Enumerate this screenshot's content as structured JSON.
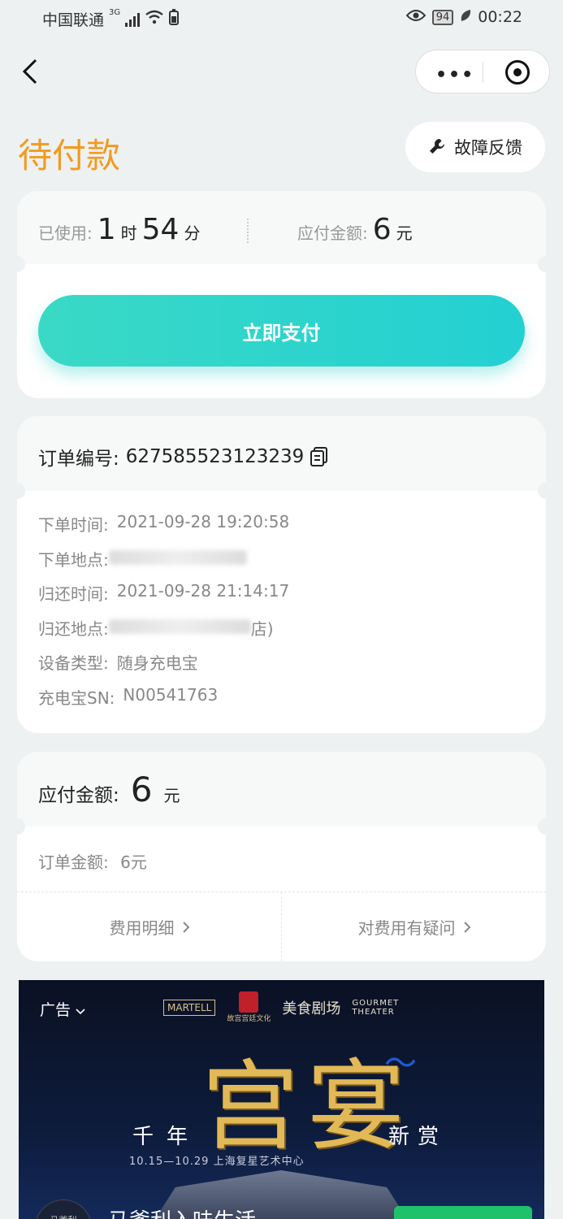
{
  "status_bar": {
    "carrier": "中国联通",
    "network": "3G",
    "battery": "94",
    "time": "00:22"
  },
  "page": {
    "title": "待付款",
    "feedback_label": "故障反馈"
  },
  "usage": {
    "used_label": "已使用:",
    "hours": "1",
    "hours_unit": "时",
    "minutes": "54",
    "minutes_unit": "分",
    "amount_label": "应付金额:",
    "amount": "6",
    "amount_unit": "元",
    "pay_button": "立即支付"
  },
  "order": {
    "number_label": "订单编号:",
    "number": "627585523123239",
    "rows": [
      {
        "label": "下单时间:",
        "value": "2021-09-28 19:20:58"
      },
      {
        "label": "下单地点:",
        "value": ""
      },
      {
        "label": "归还时间:",
        "value": "2021-09-28 21:14:17"
      },
      {
        "label": "归还地点:",
        "value": "店)"
      },
      {
        "label": "设备类型:",
        "value": "随身充电宝"
      },
      {
        "label": "充电宝SN:",
        "value": "N00541763"
      }
    ]
  },
  "payment": {
    "due_label": "应付金额:",
    "due_amount": "6",
    "due_unit": "元",
    "order_amount_label": "订单金额:",
    "order_amount": "6元",
    "detail_link": "费用明细",
    "question_link": "对费用有疑问"
  },
  "ad": {
    "label": "广告",
    "brand_1": "MARTELL",
    "brand_2": "故宫宫廷文化",
    "brand_3": "美食剧场",
    "brand_3_en_1": "GOURMET",
    "brand_3_en_2": "THEATER",
    "hero_text": "宫宴",
    "left_text": "千年",
    "right_text": "新赏",
    "date_line": "10.15—10.29  上海复星艺术中心",
    "bottom_text": "马爹利入味生活",
    "logo_text": "马爹利"
  }
}
